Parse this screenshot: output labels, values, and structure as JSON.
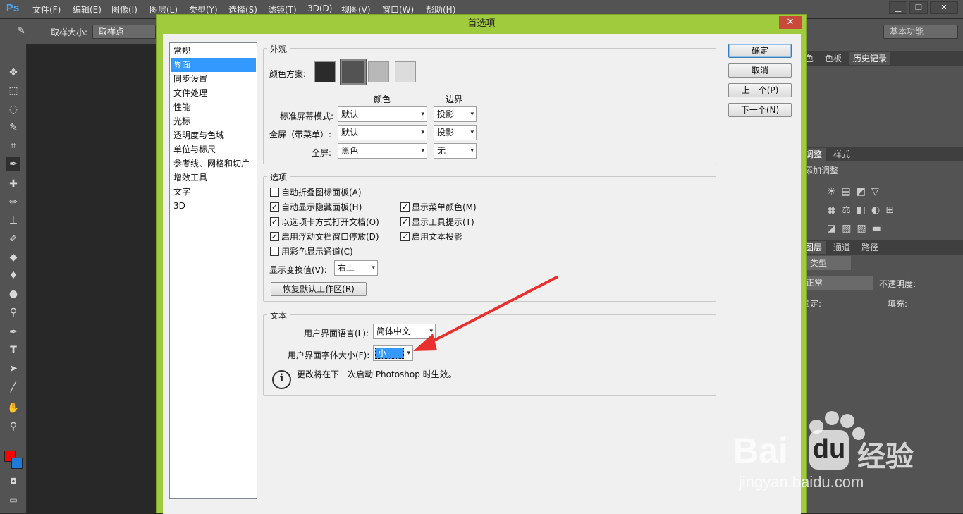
{
  "app": {
    "logo": "Ps",
    "menus": [
      "文件(F)",
      "编辑(E)",
      "图像(I)",
      "图层(L)",
      "类型(Y)",
      "选择(S)",
      "滤镜(T)",
      "3D(D)",
      "视图(V)",
      "窗口(W)",
      "帮助(H)"
    ],
    "win_min": "▁",
    "win_restore": "❐",
    "win_close": "✕"
  },
  "options": {
    "sample_size_label": "取样大小:",
    "sample_size_value": "取样点",
    "workspace": "基本功能"
  },
  "right_panel": {
    "tabs_top": [
      "色",
      "色板",
      "历史记录"
    ],
    "tabs_mid": [
      "调整",
      "样式"
    ],
    "adjust_title": "添加调整",
    "tabs_layers": [
      "图层",
      "通道",
      "路径"
    ],
    "kind": "类型",
    "blend": "正常",
    "opacity_label": "不透明度:",
    "lock_label": "锁定:",
    "fill_label": "填充:"
  },
  "dialog": {
    "title": "首选项",
    "close": "✕",
    "categories": [
      "常规",
      "界面",
      "同步设置",
      "文件处理",
      "性能",
      "光标",
      "透明度与色域",
      "单位与标尺",
      "参考线、网格和切片",
      "增效工具",
      "文字",
      "3D"
    ],
    "selected_category": "界面",
    "appearance": {
      "title": "外观",
      "color_scheme_label": "颜色方案:",
      "swatches": [
        "#2b2b2b",
        "#535353",
        "#b8b8b8",
        "#dcdcdc"
      ],
      "col_color": "颜色",
      "col_border": "边界",
      "rows": [
        {
          "label": "标准屏幕模式:",
          "color": "默认",
          "border": "投影"
        },
        {
          "label": "全屏（带菜单）:",
          "color": "默认",
          "border": "投影"
        },
        {
          "label": "全屏:",
          "color": "黑色",
          "border": "无"
        }
      ]
    },
    "options_group": {
      "title": "选项",
      "checks_left": [
        {
          "label": "自动折叠图标面板(A)",
          "checked": false
        },
        {
          "label": "自动显示隐藏面板(H)",
          "checked": true
        },
        {
          "label": "以选项卡方式打开文档(O)",
          "checked": true
        },
        {
          "label": "启用浮动文档窗口停放(D)",
          "checked": true
        },
        {
          "label": "用彩色显示通道(C)",
          "checked": false
        }
      ],
      "checks_right": [
        {
          "label": "显示菜单颜色(M)",
          "checked": true
        },
        {
          "label": "显示工具提示(T)",
          "checked": true
        },
        {
          "label": "启用文本投影",
          "checked": true
        }
      ],
      "transform_label": "显示变换值(V):",
      "transform_value": "右上",
      "reset_button": "恢复默认工作区(R)"
    },
    "text_group": {
      "title": "文本",
      "lang_label": "用户界面语言(L):",
      "lang_value": "简体中文",
      "font_label": "用户界面字体大小(F):",
      "font_value": "小",
      "note": "更改将在下一次启动 Photoshop 时生效。",
      "info_icon": "i"
    },
    "buttons": {
      "ok": "确定",
      "cancel": "取消",
      "prev": "上一个(P)",
      "next": "下一个(N)"
    },
    "check_mark": "✓",
    "arrow_glyph": "▾"
  },
  "watermark": {
    "brand": "Bai",
    "brand2": "du",
    "brand3": "经验",
    "url": "jingyan.baidu.com"
  },
  "colors": {
    "accent": "#9fcb3c",
    "selection": "#3399ff",
    "arrow": "#e8312f",
    "fg": "#ff0000",
    "bg": "#1e7bd8"
  }
}
